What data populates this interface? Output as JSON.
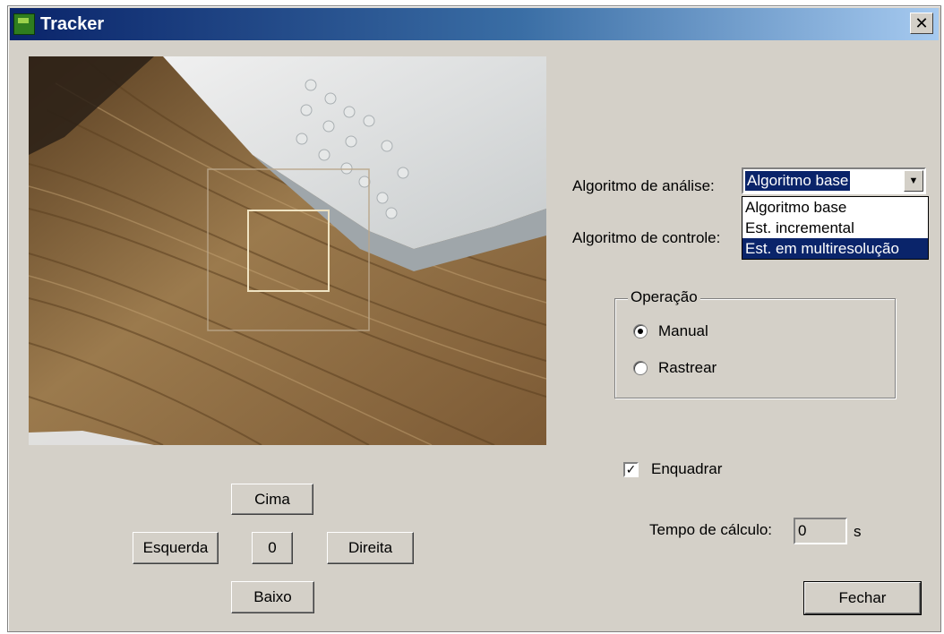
{
  "window": {
    "title": "Tracker",
    "close_glyph": "✕"
  },
  "analysis": {
    "label": "Algoritmo de análise:",
    "selected": "Algoritmo base",
    "options": [
      "Algoritmo base",
      "Est. incremental",
      "Est. em multiresolução"
    ]
  },
  "control": {
    "label": "Algoritmo de controle:"
  },
  "operation": {
    "legend": "Operação",
    "options": [
      {
        "label": "Manual",
        "checked": true
      },
      {
        "label": "Rastrear",
        "checked": false
      }
    ]
  },
  "frame": {
    "label": "Enquadrar",
    "checked": true,
    "mark": "✓"
  },
  "time": {
    "label": "Tempo de cálculo:",
    "value": "0",
    "unit": "s"
  },
  "nav": {
    "up": "Cima",
    "left": "Esquerda",
    "center": "0",
    "right": "Direita",
    "down": "Baixo"
  },
  "close_button": "Fechar",
  "icons": {
    "combo_arrow": "▼"
  }
}
